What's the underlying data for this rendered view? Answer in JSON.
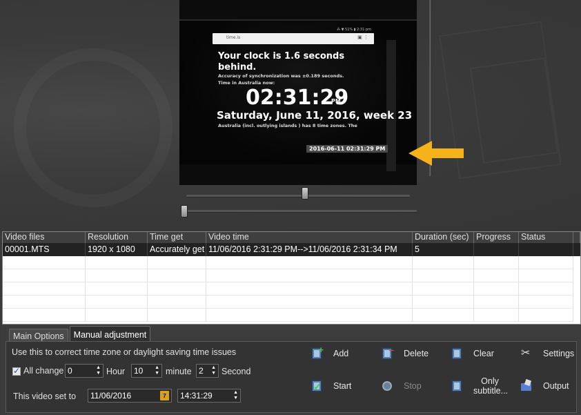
{
  "video": {
    "mini_status": "⁂ ▼ 51% ▮ 2:31 pm",
    "url": "time.is",
    "headline": "Your clock is 1.6 seconds behind.",
    "accuracy": "Accuracy of synchronization was ±0.189 seconds.",
    "tz_label": "Time in Australia now:",
    "clock": "02:31:29",
    "clock_ampm": "PM",
    "date_line": "Saturday, June 11, 2016, week 23",
    "islands_line": "Australia (incl. outlying islands ) has 8 time zones. The",
    "timestamp": "2016-06-11   02:31:29 PM"
  },
  "table": {
    "columns": [
      "Video files",
      "Resolution",
      "Time get",
      "Video time",
      "Duration (sec)",
      "Progress",
      "Status",
      ""
    ],
    "rows": [
      [
        "00001.MTS",
        "1920 x 1080",
        "Accurately get",
        "11/06/2016 2:31:29 PM-->11/06/2016 2:31:34 PM",
        "5",
        "",
        "",
        ""
      ]
    ]
  },
  "panel": {
    "tabs": [
      "Main Options",
      "Manual adjustment"
    ],
    "hint": "Use this to correct time zone or daylight saving time issues",
    "all_change_label": "All change",
    "hour_value": "0",
    "hour_label": "Hour",
    "minute_value": "10",
    "minute_label": "minute",
    "second_value": "2",
    "second_label": "Second",
    "set_to_label": "This video set to",
    "date_value": "11/06/2016",
    "time_value": "14:31:29",
    "calendar_day": "7"
  },
  "buttons": {
    "add": "Add",
    "delete": "Delete",
    "clear": "Clear",
    "settings": "Settings",
    "start": "Start",
    "stop": "Stop",
    "only_subtitle": "Only subtitle...",
    "output": "Output"
  },
  "colors": {
    "arrow": "#f5b21a",
    "panel_bg": "#3c3c3c",
    "selected_row": "#222222"
  }
}
